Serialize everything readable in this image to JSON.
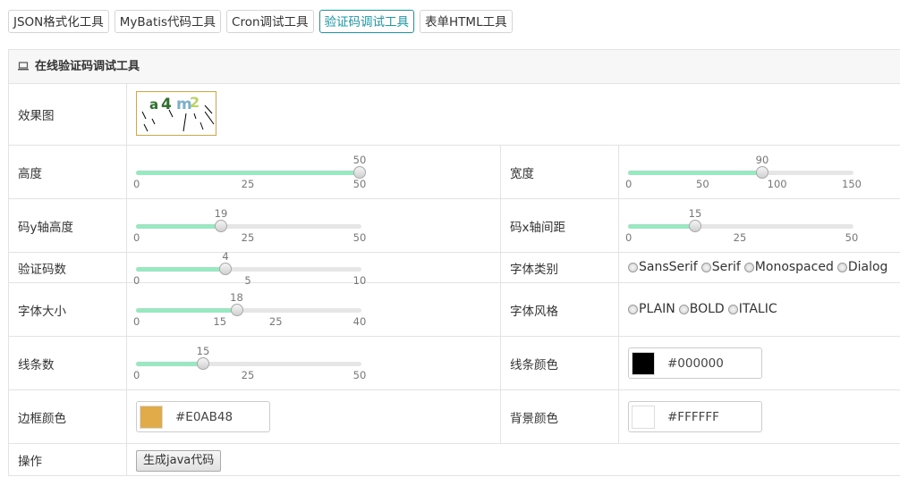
{
  "tabs": [
    {
      "label": "JSON格式化工具",
      "active": false
    },
    {
      "label": "MyBatis代码工具",
      "active": false
    },
    {
      "label": "Cron调试工具",
      "active": false
    },
    {
      "label": "验证码调试工具",
      "active": true
    },
    {
      "label": "表单HTML工具",
      "active": false
    }
  ],
  "panel": {
    "title": "在线验证码调试工具"
  },
  "preview": {
    "label": "效果图",
    "captcha_text": "a4 m2"
  },
  "height": {
    "label": "高度",
    "value": 50,
    "min": 0,
    "max": 50,
    "ticks": [
      "0",
      "25",
      "50"
    ]
  },
  "width": {
    "label": "宽度",
    "value": 90,
    "min": 0,
    "max": 150,
    "ticks": [
      "0",
      "50",
      "100",
      "150"
    ]
  },
  "y_offset": {
    "label": "码y轴高度",
    "value": 19,
    "min": 0,
    "max": 50,
    "ticks": [
      "0",
      "25",
      "50"
    ]
  },
  "x_spacing": {
    "label": "码x轴间距",
    "value": 15,
    "min": 0,
    "max": 50,
    "ticks": [
      "0",
      "25",
      "50"
    ]
  },
  "code_count": {
    "label": "验证码数",
    "value": 4,
    "min": 0,
    "max": 10,
    "ticks": [
      "0",
      "5",
      "10"
    ]
  },
  "font_family": {
    "label": "字体类别",
    "options": [
      "SansSerif",
      "Serif",
      "Monospaced",
      "Dialog"
    ]
  },
  "font_size": {
    "label": "字体大小",
    "value": 18,
    "min": 0,
    "max": 40,
    "ticks": [
      "0",
      "15",
      "25",
      "40"
    ]
  },
  "font_style": {
    "label": "字体风格",
    "options": [
      "PLAIN",
      "BOLD",
      "ITALIC"
    ]
  },
  "line_count": {
    "label": "线条数",
    "value": 15,
    "min": 0,
    "max": 50,
    "ticks": [
      "0",
      "25",
      "50"
    ]
  },
  "line_color": {
    "label": "线条颜色",
    "value": "#000000"
  },
  "border_color": {
    "label": "边框颜色",
    "value": "#E0AB48"
  },
  "bg_color": {
    "label": "背景颜色",
    "value": "#FFFFFF"
  },
  "action": {
    "label": "操作",
    "button": "生成java代码"
  }
}
